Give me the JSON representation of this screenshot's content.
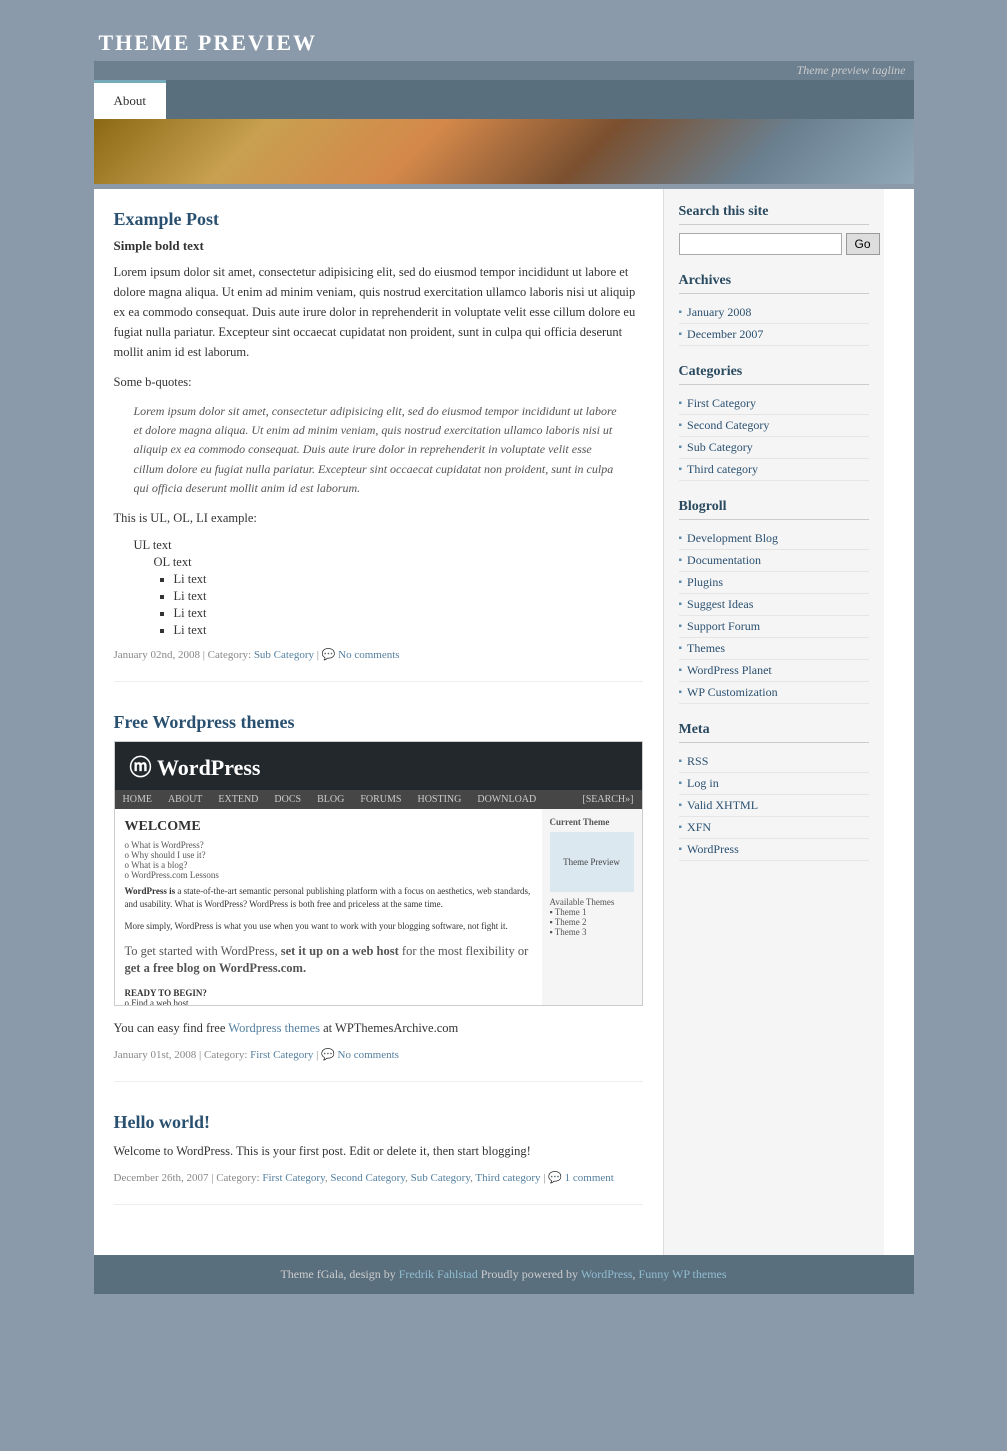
{
  "site": {
    "title": "THEME PREVIEW",
    "tagline": "Theme preview tagline"
  },
  "nav": {
    "items": [
      {
        "label": "About",
        "active": true
      }
    ]
  },
  "banner": {
    "alt": "Theme banner image"
  },
  "posts": [
    {
      "id": "example-post",
      "title": "Example Post",
      "subtitle": "Simple bold text",
      "body": "Lorem ipsum dolor sit amet, consectetur adipisicing elit, sed do eiusmod tempor incididunt ut labore et dolore magna aliqua. Ut enim ad minim veniam, quis nostrud exercitation ullamco laboris nisi ut aliquip ex ea commodo consequat. Duis aute irure dolor in reprehenderit in voluptate velit esse cillum dolore eu fugiat nulla pariatur. Excepteur sint occaecat cupidatat non proident, sunt in culpa qui officia deserunt mollit anim id est laborum.",
      "blockquote": "Lorem ipsum dolor sit amet, consectetur adipisicing elit, sed do eiusmod tempor incididunt ut labore et dolore magna aliqua. Ut enim ad minim veniam, quis nostrud exercitation ullamco laboris nisi ut aliquip ex ea commodo consequat. Duis aute irure dolor in reprehenderit in voluptate velit esse cillum dolore eu fugiat nulla pariatur. Excepteur sint occaecat cupidatat non proident, sunt in culpa qui officia deserunt mollit anim id est laborum.",
      "ul_intro": "This is UL, OL, LI example:",
      "ul_label": "UL text",
      "ol_label": "OL text",
      "li_items": [
        "Li text",
        "Li text",
        "Li text",
        "Li text"
      ],
      "meta_date": "January 02nd, 2008",
      "meta_category_label": "Category:",
      "meta_category": "Sub Category",
      "meta_comments": "No comments"
    },
    {
      "id": "free-wordpress-themes",
      "title": "Free Wordpress themes",
      "body_before": "You can easy find free ",
      "link_text": "Wordpress themes",
      "body_after": " at WPThemesArchive.com",
      "meta_date": "January 01st, 2008",
      "meta_category_label": "Category:",
      "meta_category": "First Category",
      "meta_comments": "No comments"
    },
    {
      "id": "hello-world",
      "title": "Hello world!",
      "body": "Welcome to WordPress. This is your first post. Edit or delete it, then start blogging!",
      "meta_date": "December 26th, 2007",
      "meta_category_label": "Category:",
      "meta_categories": [
        "First Category",
        "Second Category",
        "Sub Category",
        "Third category"
      ],
      "meta_comments": "1 comment"
    }
  ],
  "sidebar": {
    "search": {
      "label": "Search this site",
      "placeholder": "",
      "button": "Go"
    },
    "archives": {
      "title": "Archives",
      "items": [
        {
          "label": "January 2008"
        },
        {
          "label": "December 2007"
        }
      ]
    },
    "categories": {
      "title": "Categories",
      "items": [
        {
          "label": "First Category"
        },
        {
          "label": "Second Category"
        },
        {
          "label": "Sub Category"
        },
        {
          "label": "Third category"
        }
      ]
    },
    "blogroll": {
      "title": "Blogroll",
      "items": [
        {
          "label": "Development Blog"
        },
        {
          "label": "Documentation"
        },
        {
          "label": "Plugins"
        },
        {
          "label": "Suggest Ideas"
        },
        {
          "label": "Support Forum"
        },
        {
          "label": "Themes"
        },
        {
          "label": "WordPress Planet"
        },
        {
          "label": "WP Customization"
        }
      ]
    },
    "meta": {
      "title": "Meta",
      "items": [
        {
          "label": "RSS"
        },
        {
          "label": "Log in"
        },
        {
          "label": "Valid XHTML"
        },
        {
          "label": "XFN"
        },
        {
          "label": "WordPress"
        }
      ]
    }
  },
  "footer": {
    "text_before": "Theme fGala, design by ",
    "designer": "Fredrik Fahlstad",
    "text_middle": " Proudly powered by ",
    "powered_by": "WordPress",
    "separator": ", ",
    "themes_link": "Funny WP themes"
  },
  "wp_preview": {
    "nav_items": [
      "HOME",
      "ABOUT",
      "EXTEND",
      "DOCS",
      "BLOG",
      "FORUMS",
      "HOSTING",
      "DOWNLOAD"
    ],
    "welcome_text": "WELCOME",
    "main_text": "WordPress is a state-of-the-art semantic personal publishing platform with a focus on aesthetics, web standards, and usability. What is WordPress? WordPress is both free and priceless at the same time.",
    "extra_text": "More simply, WordPress is what you use when you want to work with your blogging software, not fight it.",
    "setup_text": "To get started with WordPress, set it up on a web host for the most flexibility or get a free blog on WordPress.com.",
    "sidebar_header": "Current Theme"
  }
}
